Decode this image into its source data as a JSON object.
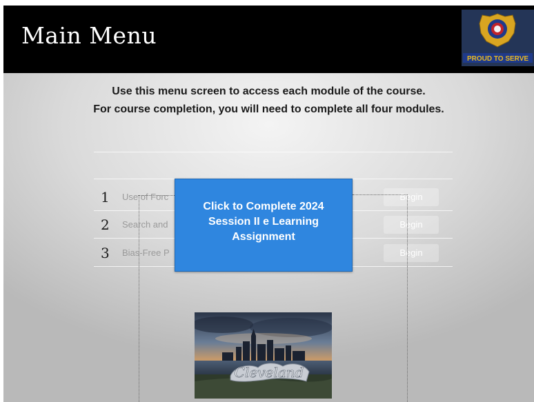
{
  "header": {
    "title": "Main Menu",
    "logo_text": "PROUD TO SERVE"
  },
  "instructions": {
    "line1": "Use this menu screen to access each module of the course.",
    "line2": "For course completion, you will need to complete all four modules."
  },
  "modules": [
    {
      "number": "1",
      "name": "Use of Forc",
      "begin_label": "Begin"
    },
    {
      "number": "2",
      "name": "Search and",
      "begin_label": "Begin"
    },
    {
      "number": "3",
      "name": "Bias-Free P",
      "begin_label": "Begin"
    }
  ],
  "overlay": {
    "line1": "Click to Complete 2024",
    "line2": "Session II e Learning",
    "line3": "Assignment"
  },
  "photo": {
    "sign_text": "Cleveland"
  },
  "colors": {
    "header_bg": "#000000",
    "overlay_bg": "#2f86df",
    "badge_gold": "#d9a521",
    "badge_blue": "#1f3a8a"
  }
}
